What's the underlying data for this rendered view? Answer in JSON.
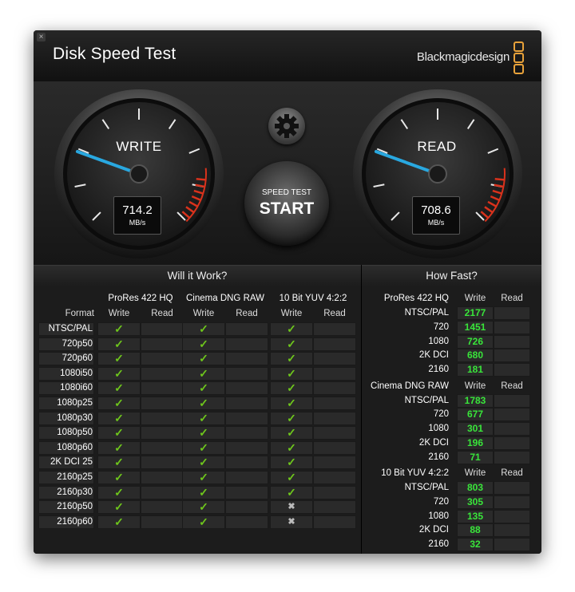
{
  "app": {
    "title": "Disk Speed Test",
    "brand": "Blackmagicdesign",
    "close_glyph": "×"
  },
  "gauges": {
    "write": {
      "label": "WRITE",
      "value": "714.2",
      "unit": "MB/s"
    },
    "read": {
      "label": "READ",
      "value": "708.6",
      "unit": "MB/s"
    }
  },
  "start_button": {
    "small": "SPEED TEST",
    "big": "START"
  },
  "will_it_work": {
    "title": "Will it Work?",
    "format_header": "Format",
    "codecs": [
      "ProRes 422 HQ",
      "Cinema DNG RAW",
      "10 Bit YUV 4:2:2"
    ],
    "write_label": "Write",
    "read_label": "Read",
    "formats": [
      "NTSC/PAL",
      "720p50",
      "720p60",
      "1080i50",
      "1080i60",
      "1080p25",
      "1080p30",
      "1080p50",
      "1080p60",
      "2K DCI 25",
      "2160p25",
      "2160p30",
      "2160p50",
      "2160p60"
    ],
    "write_results": [
      [
        "ok",
        "ok",
        "ok"
      ],
      [
        "ok",
        "ok",
        "ok"
      ],
      [
        "ok",
        "ok",
        "ok"
      ],
      [
        "ok",
        "ok",
        "ok"
      ],
      [
        "ok",
        "ok",
        "ok"
      ],
      [
        "ok",
        "ok",
        "ok"
      ],
      [
        "ok",
        "ok",
        "ok"
      ],
      [
        "ok",
        "ok",
        "ok"
      ],
      [
        "ok",
        "ok",
        "ok"
      ],
      [
        "ok",
        "ok",
        "ok"
      ],
      [
        "ok",
        "ok",
        "ok"
      ],
      [
        "ok",
        "ok",
        "ok"
      ],
      [
        "ok",
        "ok",
        "fail"
      ],
      [
        "ok",
        "ok",
        "fail"
      ]
    ]
  },
  "how_fast": {
    "title": "How Fast?",
    "write_label": "Write",
    "read_label": "Read",
    "groups": [
      {
        "codec": "ProRes 422 HQ",
        "rows": [
          {
            "format": "NTSC/PAL",
            "write": "2177"
          },
          {
            "format": "720",
            "write": "1451"
          },
          {
            "format": "1080",
            "write": "726"
          },
          {
            "format": "2K DCI",
            "write": "680"
          },
          {
            "format": "2160",
            "write": "181"
          }
        ]
      },
      {
        "codec": "Cinema DNG RAW",
        "rows": [
          {
            "format": "NTSC/PAL",
            "write": "1783"
          },
          {
            "format": "720",
            "write": "677"
          },
          {
            "format": "1080",
            "write": "301"
          },
          {
            "format": "2K DCI",
            "write": "196"
          },
          {
            "format": "2160",
            "write": "71"
          }
        ]
      },
      {
        "codec": "10 Bit YUV 4:2:2",
        "rows": [
          {
            "format": "NTSC/PAL",
            "write": "803"
          },
          {
            "format": "720",
            "write": "305"
          },
          {
            "format": "1080",
            "write": "135"
          },
          {
            "format": "2K DCI",
            "write": "88"
          },
          {
            "format": "2160",
            "write": "32"
          }
        ]
      }
    ]
  },
  "glyphs": {
    "ok": "✓",
    "fail": "✖"
  },
  "colors": {
    "accent_needle": "#29a8e0",
    "value_green": "#39e53a",
    "check_green": "#6ec61c",
    "redline": "#d9321c",
    "brand_orange": "#e8a23a"
  }
}
